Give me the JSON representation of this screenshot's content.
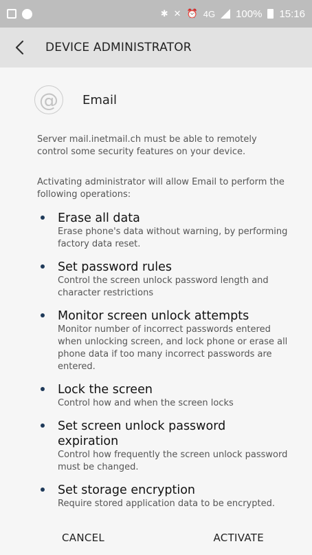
{
  "status_bar": {
    "battery_percent": "100%",
    "time": "15:16",
    "network": "4G",
    "icons": [
      "image-icon",
      "notification-face-icon",
      "bluetooth-icon",
      "mute-icon",
      "alarm-icon",
      "signal-icon",
      "battery-icon"
    ]
  },
  "app_bar": {
    "title": "DEVICE ADMINISTRATOR"
  },
  "app": {
    "name": "Email",
    "icon_glyph": "@"
  },
  "server_text": "Server mail.inetmail.ch must be able to remotely control some security features on your device.",
  "intro_text": "Activating administrator will allow Email to perform the following operations:",
  "operations": [
    {
      "title": "Erase all data",
      "desc": "Erase phone's data without warning, by performing factory data reset."
    },
    {
      "title": "Set password rules",
      "desc": "Control the screen unlock password length and character restrictions"
    },
    {
      "title": "Monitor screen unlock attempts",
      "desc": "Monitor number of incorrect passwords entered when unlocking screen, and lock phone or erase all phone data if too many incorrect passwords are entered."
    },
    {
      "title": "Lock the screen",
      "desc": "Control how and when the screen locks"
    },
    {
      "title": "Set screen unlock password expiration",
      "desc": "Control how frequently the screen unlock password must be changed."
    },
    {
      "title": "Set storage encryption",
      "desc": "Require stored application data to be encrypted."
    }
  ],
  "buttons": {
    "cancel": "CANCEL",
    "activate": "ACTIVATE"
  }
}
